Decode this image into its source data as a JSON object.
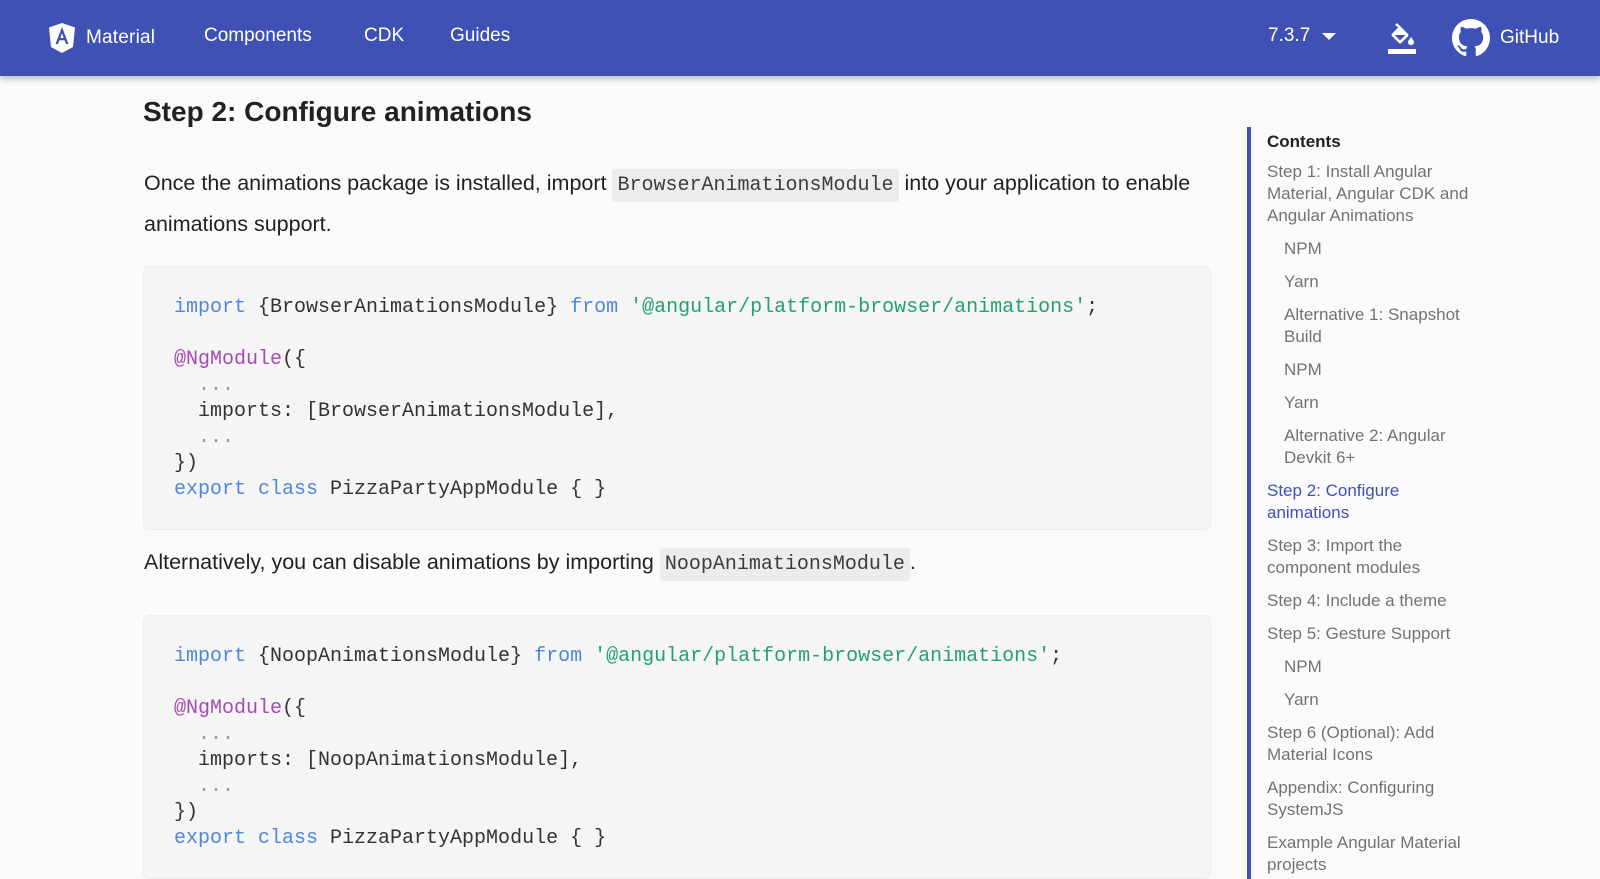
{
  "header": {
    "brand": "Material",
    "nav": [
      "Components",
      "CDK",
      "Guides"
    ],
    "version": "7.3.7",
    "github_label": "GitHub",
    "bar_color": "#3f51b5"
  },
  "main": {
    "heading": "Step 2: Configure animations",
    "para1_before": "Once the animations package is installed, import ",
    "para1_code": "BrowserAnimationsModule",
    "para1_after": " into your application to enable animations support.",
    "code1": {
      "import_kw": "import",
      "import_sym": " {BrowserAnimationsModule} ",
      "from_kw": "from",
      "path": " '@angular/platform-browser/animations'",
      "semi": ";",
      "decorator": "@NgModule",
      "open": "({",
      "dots1": "  ...",
      "imports_line": "  imports: [BrowserAnimationsModule],",
      "dots2": "  ...",
      "close": "})",
      "export_kw": "export",
      "class_kw": " class",
      "class_rest": " PizzaPartyAppModule { }"
    },
    "para2_before": "Alternatively, you can disable animations by importing ",
    "para2_code": "NoopAnimationsModule",
    "para2_after": ".",
    "code2": {
      "import_kw": "import",
      "import_sym": " {NoopAnimationsModule} ",
      "from_kw": "from",
      "path": " '@angular/platform-browser/animations'",
      "semi": ";",
      "decorator": "@NgModule",
      "open": "({",
      "dots1": "  ...",
      "imports_line": "  imports: [NoopAnimationsModule],",
      "dots2": "  ...",
      "close": "})",
      "export_kw": "export",
      "class_kw": " class",
      "class_rest": " PizzaPartyAppModule { }"
    }
  },
  "toc": {
    "title": "Contents",
    "items": [
      {
        "label": "Step 1: Install Angular Material, Angular CDK and Angular Animations",
        "level": 1
      },
      {
        "label": "NPM",
        "level": 2
      },
      {
        "label": "Yarn",
        "level": 2
      },
      {
        "label": "Alternative 1: Snapshot Build",
        "level": 2
      },
      {
        "label": "NPM",
        "level": 2
      },
      {
        "label": "Yarn",
        "level": 2
      },
      {
        "label": "Alternative 2: Angular Devkit 6+",
        "level": 2
      },
      {
        "label": "Step 2: Configure animations",
        "level": 1,
        "active": true
      },
      {
        "label": "Step 3: Import the component modules",
        "level": 1
      },
      {
        "label": "Step 4: Include a theme",
        "level": 1
      },
      {
        "label": "Step 5: Gesture Support",
        "level": 1
      },
      {
        "label": "NPM",
        "level": 2
      },
      {
        "label": "Yarn",
        "level": 2
      },
      {
        "label": "Step 6 (Optional): Add Material Icons",
        "level": 1
      },
      {
        "label": "Appendix: Configuring SystemJS",
        "level": 1
      },
      {
        "label": "Example Angular Material projects",
        "level": 1
      }
    ]
  },
  "icons": {
    "logo": "angular-shield-icon",
    "theme": "format-color-fill-icon",
    "github": "github-icon"
  }
}
